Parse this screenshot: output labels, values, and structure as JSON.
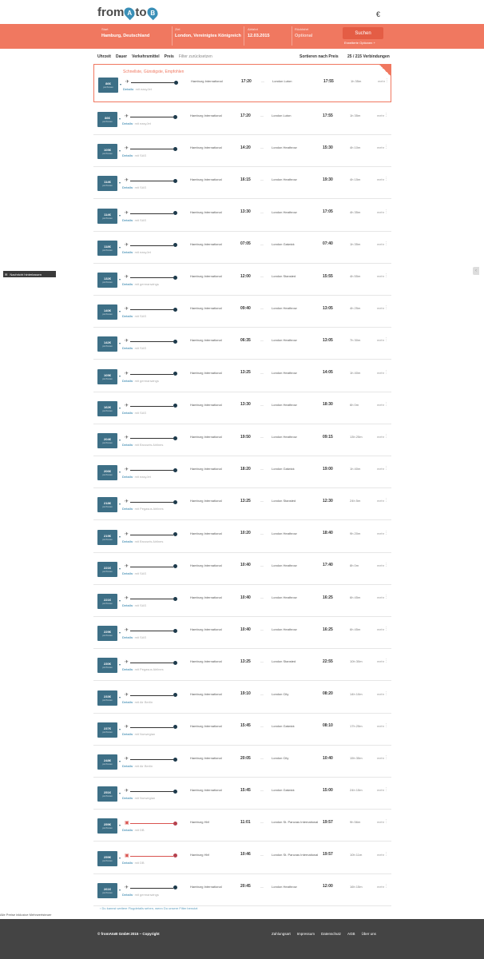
{
  "header": {
    "logo": {
      "part1": "from",
      "a": "A",
      "to": "to",
      "b": "B",
      "pin_color": "#3a8fb7"
    },
    "lang_toggle": "€"
  },
  "search": {
    "from_label": "Start",
    "from_value": "Hamburg, Deutschland",
    "to_label": "Ziel",
    "to_value": "London, Vereinigtes Königreich",
    "date_label": "Abfahrt",
    "date_value": "12.03.2015",
    "return_label": "Rückfahrt",
    "return_value": "Optional",
    "search_button": "Suchen",
    "advanced": "Erweiterte Optionen"
  },
  "filters": {
    "items": [
      "Uhrzeit",
      "Dauer",
      "Verkehrsmittel",
      "Preis"
    ],
    "reset": "Filter zurücksetzen",
    "sort": "Sortieren nach Preis",
    "count": "25 / 215 Verbindungen"
  },
  "recommended_label": "Schnellste, Günstigste, Empfohlen",
  "results": [
    {
      "price": "86€",
      "mode": "flight",
      "dep": "Hamburg International",
      "dt": "17:20",
      "arr": "London Luton",
      "at": "17:55",
      "dur": "1h 35m",
      "carrier": "easyJet"
    },
    {
      "price": "86€",
      "mode": "flight",
      "dep": "Hamburg International",
      "dt": "17:20",
      "arr": "London Luton",
      "at": "17:55",
      "dur": "1h 35m",
      "carrier": "easyJet"
    },
    {
      "price": "105€",
      "mode": "flight",
      "dep": "Hamburg International",
      "dt": "14:20",
      "arr": "London Heathrow",
      "at": "15:30",
      "dur": "4h 10m",
      "carrier": "SAS"
    },
    {
      "price": "114€",
      "mode": "flight",
      "dep": "Hamburg International",
      "dt": "16:15",
      "arr": "London Heathrow",
      "at": "19:30",
      "dur": "4h 15m",
      "carrier": "SAS"
    },
    {
      "price": "114€",
      "mode": "flight",
      "dep": "Hamburg International",
      "dt": "13:30",
      "arr": "London Heathrow",
      "at": "17:05",
      "dur": "4h 35m",
      "carrier": "SAS"
    },
    {
      "price": "118€",
      "mode": "flight",
      "dep": "Hamburg International",
      "dt": "07:05",
      "arr": "London Gatwick",
      "at": "07:40",
      "dur": "1h 35m",
      "carrier": "easyJet"
    },
    {
      "price": "132€",
      "mode": "flight",
      "dep": "Hamburg International",
      "dt": "12:00",
      "arr": "London Stansted",
      "at": "15:55",
      "dur": "4h 55m",
      "carrier": "germanwings"
    },
    {
      "price": "140€",
      "mode": "flight",
      "dep": "Hamburg International",
      "dt": "09:40",
      "arr": "London Heathrow",
      "at": "13:05",
      "dur": "4h 25m",
      "carrier": "SAS"
    },
    {
      "price": "142€",
      "mode": "flight",
      "dep": "Hamburg International",
      "dt": "06:35",
      "arr": "London Heathrow",
      "at": "13:05",
      "dur": "7h 30m",
      "carrier": "SAS"
    },
    {
      "price": "105€",
      "mode": "flight",
      "dep": "Hamburg International",
      "dt": "13:25",
      "arr": "London Heathrow",
      "at": "14:05",
      "dur": "1h 40m",
      "carrier": "germanwings"
    },
    {
      "price": "162€",
      "mode": "flight",
      "dep": "Hamburg International",
      "dt": "13:30",
      "arr": "London Heathrow",
      "at": "18:30",
      "dur": "6h 0m",
      "carrier": "SAS"
    },
    {
      "price": "204€",
      "mode": "flight",
      "dep": "Hamburg International",
      "dt": "19:50",
      "arr": "London Heathrow",
      "at": "09:15",
      "dur": "13h 25m",
      "carrier": "Brussels Airlines"
    },
    {
      "price": "206€",
      "mode": "flight",
      "dep": "Hamburg International",
      "dt": "18:20",
      "arr": "London Gatwick",
      "at": "19:00",
      "dur": "1h 40m",
      "carrier": "easyJet"
    },
    {
      "price": "218€",
      "mode": "flight",
      "dep": "Hamburg International",
      "dt": "13:25",
      "arr": "London Stansted",
      "at": "12:30",
      "dur": "24h 5m",
      "carrier": "Pegasus Airlines"
    },
    {
      "price": "219€",
      "mode": "flight",
      "dep": "Hamburg International",
      "dt": "10:20",
      "arr": "London Heathrow",
      "at": "18:40",
      "dur": "9h 20m",
      "carrier": "Brussels Airlines"
    },
    {
      "price": "221€",
      "mode": "flight",
      "dep": "Hamburg International",
      "dt": "10:40",
      "arr": "London Heathrow",
      "at": "17:40",
      "dur": "8h 0m",
      "carrier": "SAS"
    },
    {
      "price": "221€",
      "mode": "flight",
      "dep": "Hamburg International",
      "dt": "10:40",
      "arr": "London Heathrow",
      "at": "16:25",
      "dur": "6h 45m",
      "carrier": "SAS"
    },
    {
      "price": "229€",
      "mode": "flight",
      "dep": "Hamburg International",
      "dt": "10:40",
      "arr": "London Heathrow",
      "at": "16:25",
      "dur": "6h 45m",
      "carrier": "SAS"
    },
    {
      "price": "230€",
      "mode": "flight",
      "dep": "Hamburg International",
      "dt": "13:25",
      "arr": "London Stansted",
      "at": "22:55",
      "dur": "10h 30m",
      "carrier": "Pegasus Airlines"
    },
    {
      "price": "233€",
      "mode": "flight",
      "dep": "Hamburg International",
      "dt": "19:10",
      "arr": "London City",
      "at": "08:20",
      "dur": "14h 10m",
      "carrier": "Air Berlin"
    },
    {
      "price": "237€",
      "mode": "flight",
      "dep": "Hamburg International",
      "dt": "15:45",
      "arr": "London Gatwick",
      "at": "08:10",
      "dur": "17h 25m",
      "carrier": "Norwegian"
    },
    {
      "price": "248€",
      "mode": "flight",
      "dep": "Hamburg International",
      "dt": "20:05",
      "arr": "London City",
      "at": "10:40",
      "dur": "15h 35m",
      "carrier": "Air Berlin"
    },
    {
      "price": "251€",
      "mode": "flight",
      "dep": "Hamburg International",
      "dt": "15:45",
      "arr": "London Gatwick",
      "at": "15:00",
      "dur": "24h 15m",
      "carrier": "Norwegian"
    },
    {
      "price": "259€",
      "mode": "train",
      "dep": "Hamburg Hbf",
      "dt": "11:01",
      "arr": "London St. Pancras International",
      "at": "19:57",
      "dur": "9h 56m",
      "carrier": "DB"
    },
    {
      "price": "259€",
      "mode": "train",
      "dep": "Hamburg Hbf",
      "dt": "10:46",
      "arr": "London St. Pancras International",
      "at": "19:57",
      "dur": "10h 11m",
      "carrier": "DB"
    },
    {
      "price": "261€",
      "mode": "flight",
      "dep": "Hamburg International",
      "dt": "20:45",
      "arr": "London Heathrow",
      "at": "12:00",
      "dur": "16h 15m",
      "carrier": "germanwings"
    }
  ],
  "row_labels": {
    "details": "Details",
    "via": "mit",
    "price_sub": "pro Person",
    "more": "mehr",
    "dash": "—"
  },
  "more_flights": "Du kannst weitere Flugdetails sehen, wenn Du unsere Filter benutzt",
  "note": "Alle Preise inklusive Mehrwertsteuer",
  "side_button": "Nachricht hinterlassen",
  "footer": {
    "copyright": "© fromAtoB GmbH 2015 – Copyright",
    "links": [
      "Zahlungsart",
      "Impressum",
      "Datenschutz",
      "AGB",
      "Über uns"
    ]
  },
  "colors": {
    "accent": "#f07860",
    "price_bg": "#3d6f86",
    "footer_bg": "#444444"
  }
}
